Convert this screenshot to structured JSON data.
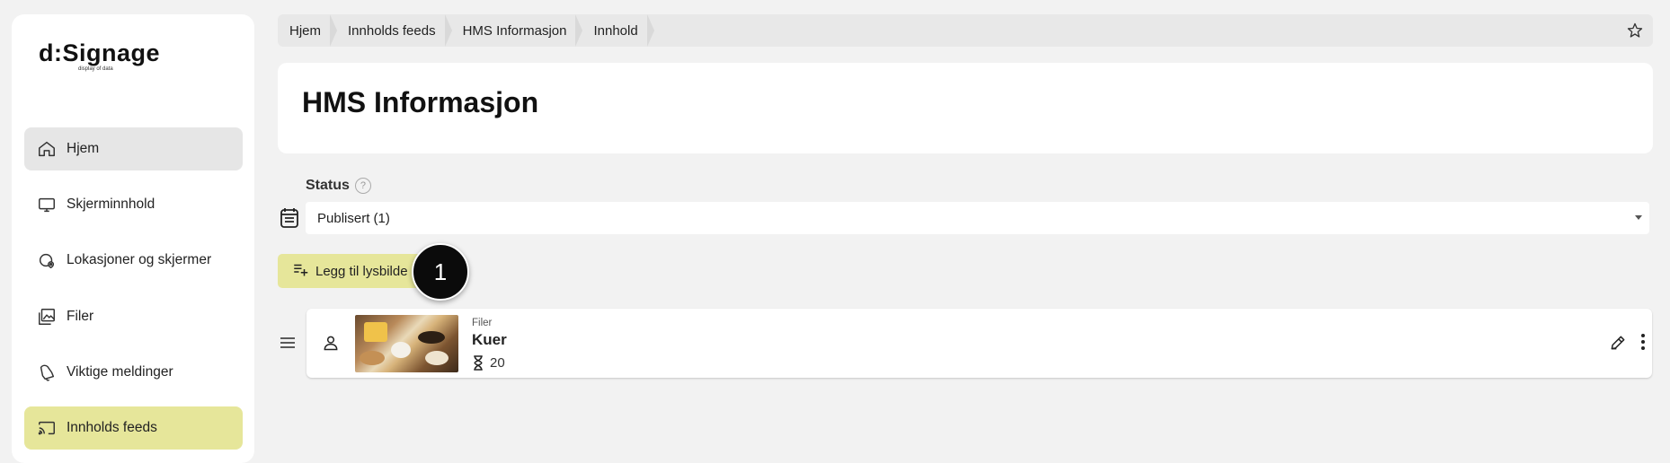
{
  "app": {
    "logo_text": "d:Signage",
    "logo_tagline": "display of data"
  },
  "sidebar": {
    "items": [
      {
        "label": "Hjem",
        "icon": "home-icon",
        "state": "hover"
      },
      {
        "label": "Skjerminnhold",
        "icon": "monitor-icon",
        "state": "normal"
      },
      {
        "label": "Lokasjoner og skjermer",
        "icon": "location-icon",
        "state": "normal"
      },
      {
        "label": "Filer",
        "icon": "images-icon",
        "state": "normal"
      },
      {
        "label": "Viktige meldinger",
        "icon": "bell-icon",
        "state": "normal"
      },
      {
        "label": "Innholds feeds",
        "icon": "cast-icon",
        "state": "active"
      }
    ]
  },
  "breadcrumb": {
    "items": [
      "Hjem",
      "Innholds feeds",
      "HMS Informasjon",
      "Innhold"
    ]
  },
  "page": {
    "title": "HMS Informasjon"
  },
  "status": {
    "label": "Status",
    "help": "?",
    "selected": "Publisert (1)"
  },
  "actions": {
    "add_slide_label": "Legg til lysbilde",
    "step_badge": "1"
  },
  "content_items": [
    {
      "type": "Filer",
      "name": "Kuer",
      "duration": "20"
    }
  ],
  "colors": {
    "accent": "#e6e69a",
    "background": "#f2f2f2",
    "card": "#ffffff"
  }
}
